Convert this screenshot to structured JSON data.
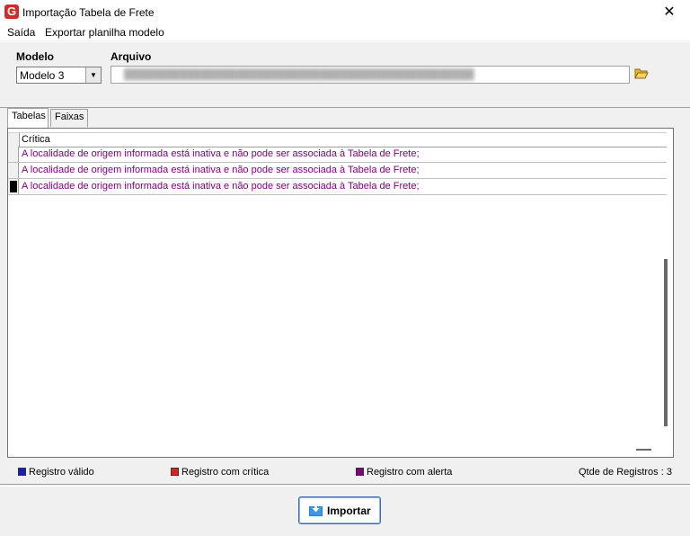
{
  "window": {
    "title": "Importação Tabela de Frete",
    "close": "✕"
  },
  "menu": {
    "items": [
      "Saída",
      "Exportar planilha modelo"
    ]
  },
  "form": {
    "modelo_label": "Modelo",
    "modelo_value": "Modelo 3",
    "arquivo_label": "Arquivo"
  },
  "tabs": [
    "Tabelas",
    "Faixas"
  ],
  "grid": {
    "header": "Crítica",
    "rows": [
      "A localidade de origem informada está inativa e não pode ser associada à Tabela de Frete;",
      "A localidade de origem informada está inativa e não pode ser associada à Tabela de Frete;",
      "A localidade de origem informada está inativa e não pode ser associada à Tabela de Frete;"
    ]
  },
  "legend": {
    "valid": {
      "label": "Registro válido",
      "color": "#1a1acc"
    },
    "critical": {
      "label": "Registro com crítica",
      "color": "#e02020"
    },
    "alert": {
      "label": "Registro com alerta",
      "color": "#800080"
    },
    "count": "Qtde de Registros : 3"
  },
  "actions": {
    "import_label": "Importar"
  }
}
